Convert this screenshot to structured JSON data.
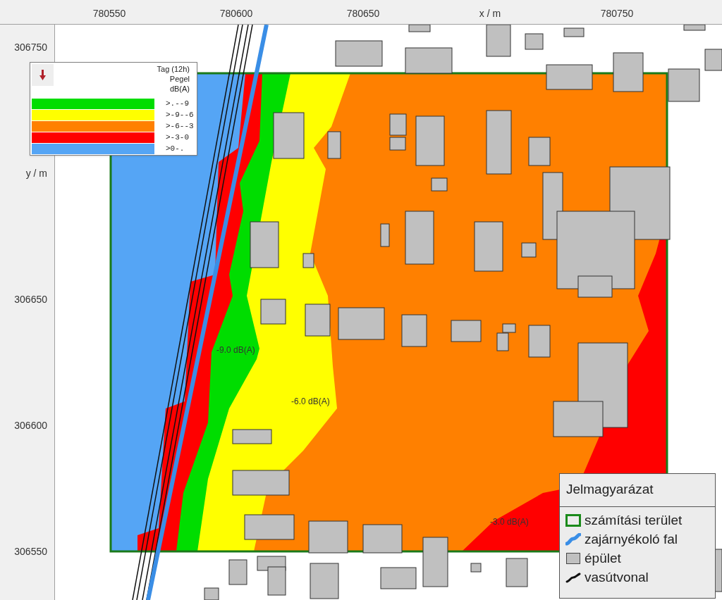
{
  "x_axis": {
    "labels": [
      "780550",
      "780600",
      "780650",
      "x / m",
      "780750"
    ]
  },
  "y_axis": {
    "labels": [
      "306750",
      "y / m",
      "306650",
      "306600",
      "306550"
    ]
  },
  "level_legend": {
    "title_lines": [
      "Tag (12h)",
      "Pegel",
      "dB(A)"
    ],
    "classes": [
      {
        "label": ">.--9",
        "color": "#00dd00"
      },
      {
        "label": ">-9--6",
        "color": "#ffff00"
      },
      {
        "label": ">-6--3",
        "color": "#ff8000"
      },
      {
        "label": ">-3-0",
        "color": "#ff0000"
      },
      {
        "label": ">0-.",
        "color": "#55a5f5"
      }
    ]
  },
  "contour_labels": [
    {
      "text": "-9.0 dB(A)"
    },
    {
      "text": "-6.0 dB(A)"
    },
    {
      "text": "-3.0 dB(A)"
    }
  ],
  "map_legend": {
    "title": "Jelmagyarázat",
    "items": [
      {
        "kind": "area",
        "label": "számítási terület"
      },
      {
        "kind": "wall",
        "label": "zajárnyékoló fal"
      },
      {
        "kind": "building",
        "label": "épület"
      },
      {
        "kind": "railway",
        "label": "vasútvonal"
      }
    ]
  }
}
